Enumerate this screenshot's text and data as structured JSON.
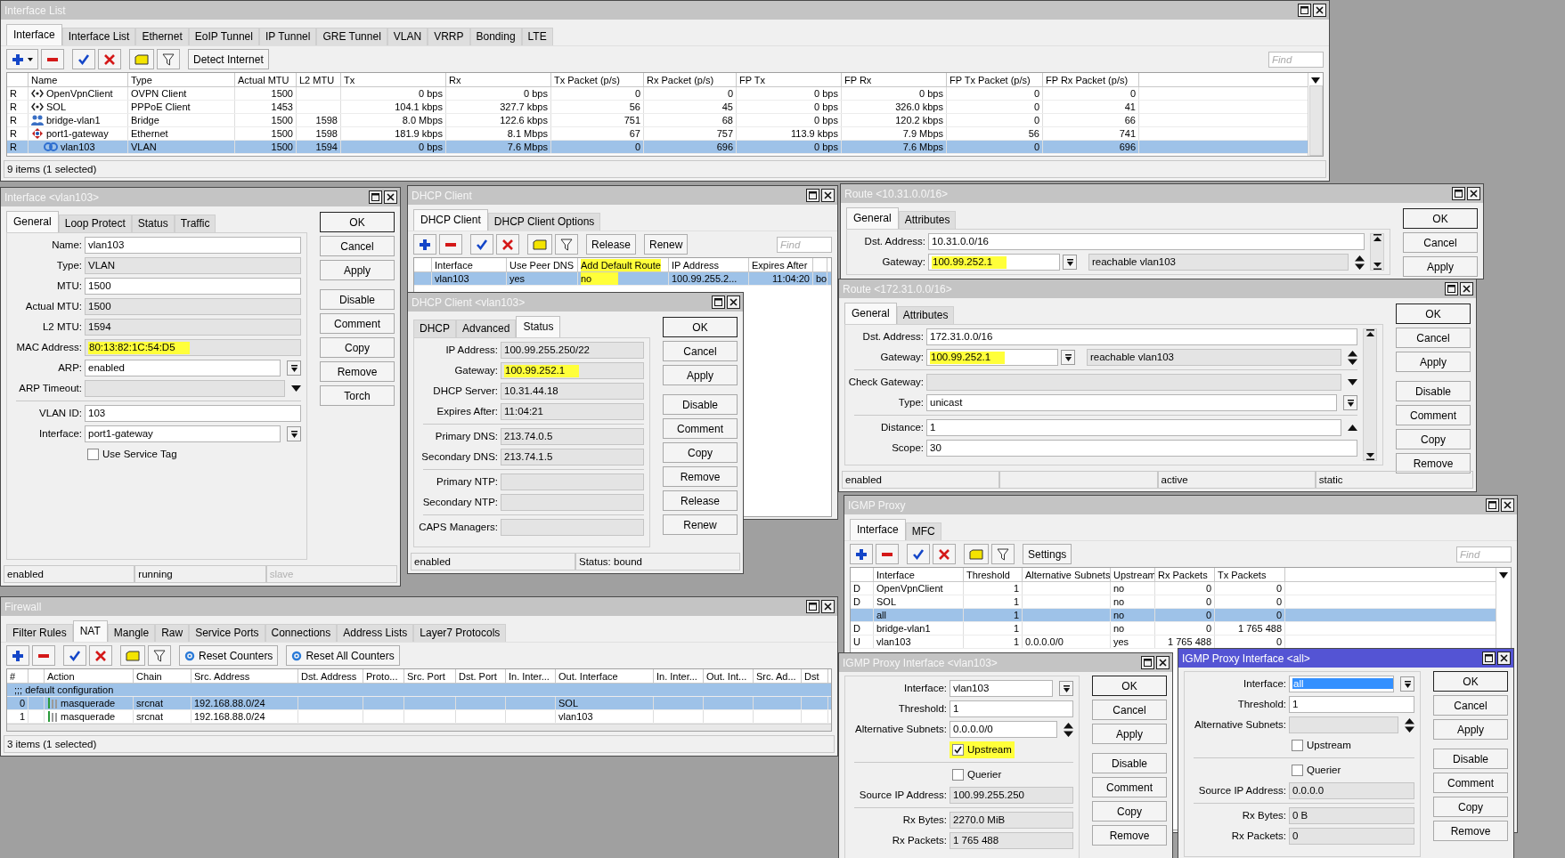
{
  "windows": [
    {
      "title": "Interface List",
      "active": false,
      "tabs": [
        {
          "label": "Interface",
          "selected": true
        },
        {
          "label": "Interface List",
          "selected": false
        },
        {
          "label": "Ethernet",
          "selected": false
        },
        {
          "label": "EoIP Tunnel",
          "selected": false
        },
        {
          "label": "IP Tunnel",
          "selected": false
        },
        {
          "label": "GRE Tunnel",
          "selected": false
        },
        {
          "label": "VLAN",
          "selected": false
        },
        {
          "label": "VRRP",
          "selected": false
        },
        {
          "label": "Bonding",
          "selected": false
        },
        {
          "label": "LTE",
          "selected": false
        }
      ],
      "toolbar": [
        {
          "kind": "add",
          "menu": true
        },
        {
          "kind": "remove"
        },
        {
          "kind": "enable"
        },
        {
          "kind": "disable"
        },
        {
          "kind": "comment"
        },
        {
          "kind": "filter"
        },
        {
          "kind": "button",
          "label": "Detect Internet"
        }
      ],
      "find": {
        "placeholder": "Find"
      },
      "table": {
        "columns": [
          "Name",
          "Type",
          "Actual MTU",
          "L2 MTU",
          "Tx",
          "Rx",
          "Tx Packet (p/s)",
          "Rx Packet (p/s)",
          "FP Tx",
          "FP Rx",
          "FP Tx Packet (p/s)",
          "FP Rx Packet (p/s)"
        ],
        "rows": [
          {
            "flag": "R",
            "kind": "tunnel",
            "selected": false,
            "cells": [
              "OpenVpnClient",
              "OVPN Client",
              "1500",
              null,
              "0 bps",
              "0 bps",
              "0",
              "0",
              "0 bps",
              "0 bps",
              "0",
              "0"
            ]
          },
          {
            "flag": "R",
            "kind": "tunnel",
            "selected": false,
            "cells": [
              "SOL",
              "PPPoE Client",
              "1453",
              null,
              "104.1 kbps",
              "327.7 kbps",
              "56",
              "45",
              "0 bps",
              "326.0 kbps",
              "0",
              "41"
            ]
          },
          {
            "flag": "R",
            "kind": "bridge",
            "selected": false,
            "cells": [
              "bridge-vlan1",
              "Bridge",
              "1500",
              "1598",
              "8.0 Mbps",
              "122.6 kbps",
              "751",
              "68",
              "0 bps",
              "120.2 kbps",
              "0",
              "66"
            ]
          },
          {
            "flag": "R",
            "kind": "ethernet",
            "selected": false,
            "cells": [
              "port1-gateway",
              "Ethernet",
              "1500",
              "1598",
              "181.9 kbps",
              "8.1 Mbps",
              "67",
              "757",
              "113.9 kbps",
              "7.9 Mbps",
              "56",
              "741"
            ],
            "children": [
              {
                "flag": "R",
                "kind": "vlan",
                "selected": true,
                "cells": [
                  "vlan103",
                  "VLAN",
                  "1500",
                  "1594",
                  "0 bps",
                  "7.6 Mbps",
                  "0",
                  "696",
                  "0 bps",
                  "7.6 Mbps",
                  "0",
                  "696"
                ]
              }
            ]
          }
        ]
      },
      "status": [
        {
          "text": "9 items (1 selected)"
        }
      ]
    },
    {
      "title": "Interface <vlan103>",
      "active": false,
      "tabs": [
        {
          "label": "General",
          "selected": true
        },
        {
          "label": "Loop Protect",
          "selected": false
        },
        {
          "label": "Status",
          "selected": false
        },
        {
          "label": "Traffic",
          "selected": false
        }
      ],
      "fields": [
        {
          "kind": "text",
          "label": "Name:",
          "value": "vlan103",
          "readonly": false
        },
        {
          "kind": "text",
          "label": "Type:",
          "value": "VLAN",
          "readonly": true
        },
        {
          "kind": "text",
          "label": "MTU:",
          "value": "1500",
          "readonly": false
        },
        {
          "kind": "text",
          "label": "Actual MTU:",
          "value": "1500",
          "readonly": true
        },
        {
          "kind": "text",
          "label": "L2 MTU:",
          "value": "1594",
          "readonly": true
        },
        {
          "kind": "text",
          "label": "MAC Address:",
          "value": "80:13:82:1C:54:D5",
          "readonly": true,
          "highlighted": true
        },
        {
          "kind": "select",
          "label": "ARP:",
          "value": "enabled",
          "readonly": false
        },
        {
          "kind": "dropdown",
          "label": "ARP Timeout:",
          "readonly": true
        },
        {
          "kind": "separator"
        },
        {
          "kind": "text",
          "label": "VLAN ID:",
          "value": "103",
          "readonly": false
        },
        {
          "kind": "select",
          "label": "Interface:",
          "value": "port1-gateway",
          "readonly": false
        },
        {
          "kind": "checkbox",
          "label": "Use Service Tag",
          "checked": false
        }
      ],
      "buttons": [
        "OK",
        "Cancel",
        "Apply",
        "Disable",
        "Comment",
        "Copy",
        "Remove",
        "Torch"
      ],
      "status": [
        {
          "text": "enabled",
          "disabled": false
        },
        {
          "text": "running",
          "disabled": false
        },
        {
          "text": "slave",
          "disabled": true
        }
      ]
    },
    {
      "title": "DHCP Client",
      "active": false,
      "tabs": [
        {
          "label": "DHCP Client",
          "selected": true
        },
        {
          "label": "DHCP Client Options",
          "selected": false
        }
      ],
      "toolbar": [
        {
          "kind": "add",
          "menu": false
        },
        {
          "kind": "remove"
        },
        {
          "kind": "enable"
        },
        {
          "kind": "disable"
        },
        {
          "kind": "comment"
        },
        {
          "kind": "filter"
        },
        {
          "kind": "button",
          "label": "Release"
        },
        {
          "kind": "button",
          "label": "Renew"
        }
      ],
      "find": {
        "placeholder": "Find"
      },
      "table": {
        "columns": [
          "Interface",
          "Use Peer DNS",
          {
            "label": "Add Default Route",
            "highlighted": true
          },
          "IP Address",
          "Expires After",
          null
        ],
        "rows": [
          {
            "flag": null,
            "kind": "none",
            "selected": true,
            "cells": [
              "vlan103",
              "yes",
              {
                "text": "no",
                "highlighted": true
              },
              "100.99.255.2...",
              "11:04:20",
              "bo"
            ]
          }
        ]
      }
    },
    {
      "title": "DHCP Client <vlan103>",
      "active": false,
      "tabs": [
        {
          "label": "DHCP",
          "selected": false
        },
        {
          "label": "Advanced",
          "selected": false
        },
        {
          "label": "Status",
          "selected": true
        }
      ],
      "fields": [
        {
          "kind": "text",
          "label": "IP Address:",
          "value": "100.99.255.250/22",
          "readonly": true
        },
        {
          "kind": "text",
          "label": "Gateway:",
          "value": "100.99.252.1",
          "readonly": true,
          "highlighted": true
        },
        {
          "kind": "text",
          "label": "DHCP Server:",
          "value": "10.31.44.18",
          "readonly": true
        },
        {
          "kind": "text",
          "label": "Expires After:",
          "value": "11:04:21",
          "readonly": true
        },
        {
          "kind": "separator"
        },
        {
          "kind": "text",
          "label": "Primary DNS:",
          "value": "213.74.0.5",
          "readonly": true
        },
        {
          "kind": "text",
          "label": "Secondary DNS:",
          "value": "213.74.1.5",
          "readonly": true
        },
        {
          "kind": "separator"
        },
        {
          "kind": "text",
          "label": "Primary NTP:",
          "readonly": true
        },
        {
          "kind": "text",
          "label": "Secondary NTP:",
          "readonly": true
        },
        {
          "kind": "separator"
        },
        {
          "kind": "text",
          "label": "CAPS Managers:",
          "readonly": true
        }
      ],
      "buttons": [
        "OK",
        "Cancel",
        "Apply",
        "Disable",
        "Comment",
        "Copy",
        "Remove",
        "Release",
        "Renew"
      ],
      "status": [
        {
          "text": "enabled"
        },
        {
          "text": "Status: bound"
        }
      ]
    },
    {
      "title": "Route <10.31.0.0/16>",
      "active": false,
      "tabs": [
        {
          "label": "General",
          "selected": true
        },
        {
          "label": "Attributes",
          "selected": false
        }
      ],
      "fields": [
        {
          "kind": "text",
          "label": "Dst. Address:",
          "value": "10.31.0.0/16",
          "readonly": false
        },
        {
          "kind": "gateway",
          "label": "Gateway:",
          "value": "100.99.252.1",
          "state": "reachable vlan103",
          "readonly": false,
          "highlighted": true
        }
      ],
      "buttons": [
        "OK",
        "Cancel",
        "Apply"
      ]
    },
    {
      "title": "Route <172.31.0.0/16>",
      "active": false,
      "tabs": [
        {
          "label": "General",
          "selected": true
        },
        {
          "label": "Attributes",
          "selected": false
        }
      ],
      "fields": [
        {
          "kind": "text",
          "label": "Dst. Address:",
          "value": "172.31.0.0/16",
          "readonly": false
        },
        {
          "kind": "gateway",
          "label": "Gateway:",
          "value": "100.99.252.1",
          "state": "reachable vlan103",
          "readonly": false,
          "highlighted": true
        },
        {
          "kind": "separator"
        },
        {
          "kind": "dropdown",
          "label": "Check Gateway:",
          "readonly": true
        },
        {
          "kind": "select",
          "label": "Type:",
          "value": "unicast",
          "readonly": false
        },
        {
          "kind": "separator"
        },
        {
          "kind": "up",
          "label": "Distance:",
          "value": "1",
          "readonly": false
        },
        {
          "kind": "text",
          "label": "Scope:",
          "value": "30",
          "readonly": false
        }
      ],
      "buttons": [
        "OK",
        "Cancel",
        "Apply",
        "Disable",
        "Comment",
        "Copy",
        "Remove"
      ],
      "status": [
        {
          "text": "enabled"
        },
        {
          "text": "active"
        },
        {
          "text": "static"
        }
      ]
    },
    {
      "title": "Firewall",
      "active": false,
      "tabs": [
        {
          "label": "Filter Rules",
          "selected": false
        },
        {
          "label": "NAT",
          "selected": true
        },
        {
          "label": "Mangle",
          "selected": false
        },
        {
          "label": "Raw",
          "selected": false
        },
        {
          "label": "Service Ports",
          "selected": false
        },
        {
          "label": "Connections",
          "selected": false
        },
        {
          "label": "Address Lists",
          "selected": false
        },
        {
          "label": "Layer7 Protocols",
          "selected": false
        }
      ],
      "toolbar": [
        {
          "kind": "add",
          "menu": false
        },
        {
          "kind": "remove"
        },
        {
          "kind": "enable"
        },
        {
          "kind": "disable"
        },
        {
          "kind": "comment"
        },
        {
          "kind": "filter"
        },
        {
          "kind": "reset",
          "label": "Reset Counters"
        },
        {
          "kind": "reset",
          "label": "Reset All Counters"
        }
      ],
      "table": {
        "columns": [
          "#",
          null,
          "Action",
          "Chain",
          "Src. Address",
          "Dst. Address",
          "Proto...",
          "Src. Port",
          "Dst. Port",
          "In. Inter...",
          "Out. Interface",
          "In. Inter...",
          "Out. Int...",
          "Src. Ad...",
          "Dst"
        ],
        "rows": [
          {
            "kind": "comment",
            "text": ";;; default configuration",
            "selected": true
          },
          {
            "kind": "masquerade",
            "selected": true,
            "cells": [
              "0",
              null,
              "masquerade",
              "srcnat",
              "192.168.88.0/24",
              null,
              null,
              null,
              null,
              null,
              "SOL",
              null,
              null,
              null,
              null
            ]
          },
          {
            "kind": "masquerade",
            "selected": false,
            "cells": [
              "1",
              null,
              "masquerade",
              "srcnat",
              "192.168.88.0/24",
              null,
              null,
              null,
              null,
              null,
              "vlan103",
              null,
              null,
              null,
              null
            ]
          }
        ]
      },
      "status": [
        {
          "text": "3 items (1 selected)"
        }
      ]
    },
    {
      "title": "IGMP Proxy",
      "active": false,
      "tabs": [
        {
          "label": "Interface",
          "selected": true
        },
        {
          "label": "MFC",
          "selected": false
        }
      ],
      "toolbar": [
        {
          "kind": "add",
          "menu": false
        },
        {
          "kind": "remove"
        },
        {
          "kind": "enable"
        },
        {
          "kind": "disable"
        },
        {
          "kind": "comment"
        },
        {
          "kind": "filter"
        },
        {
          "kind": "button",
          "label": "Settings"
        }
      ],
      "find": {
        "placeholder": "Find"
      },
      "table": {
        "columns": [
          "Interface",
          "Threshold",
          "Alternative Subnets",
          "Upstream",
          "Rx Packets",
          "Tx Packets"
        ],
        "rows": [
          {
            "flag": "D",
            "kind": "none",
            "selected": false,
            "cells": [
              "OpenVpnClient",
              "1",
              null,
              "no",
              "0",
              "0"
            ]
          },
          {
            "flag": "D",
            "kind": "none",
            "selected": false,
            "cells": [
              "SOL",
              "1",
              null,
              "no",
              "0",
              "0"
            ]
          },
          {
            "flag": null,
            "kind": "none",
            "selected": true,
            "cells": [
              "all",
              "1",
              null,
              "no",
              "0",
              "0"
            ]
          },
          {
            "flag": "D",
            "kind": "none",
            "selected": false,
            "cells": [
              "bridge-vlan1",
              "1",
              null,
              "no",
              "0",
              "1 765 488"
            ]
          },
          {
            "flag": "U",
            "kind": "none",
            "selected": false,
            "cells": [
              "vlan103",
              "1",
              "0.0.0.0/0",
              "yes",
              "1 765 488",
              "0"
            ]
          }
        ]
      }
    },
    {
      "title": "IGMP Proxy Interface <vlan103>",
      "active": false,
      "fields": [
        {
          "kind": "select",
          "label": "Interface:",
          "value": "vlan103",
          "readonly": false
        },
        {
          "kind": "text",
          "label": "Threshold:",
          "value": "1",
          "readonly": false
        },
        {
          "kind": "spin",
          "label": "Alternative Subnets:",
          "value": "0.0.0.0/0",
          "readonly": false
        },
        {
          "kind": "checkbox",
          "label": "Upstream",
          "checked": true,
          "highlighted": true
        },
        {
          "kind": "separator"
        },
        {
          "kind": "checkbox",
          "label": "Querier",
          "checked": false
        },
        {
          "kind": "text",
          "label": "Source IP Address:",
          "value": "100.99.255.250",
          "readonly": true
        },
        {
          "kind": "separator"
        },
        {
          "kind": "text",
          "label": "Rx Bytes:",
          "value": "2270.0 MiB",
          "readonly": true
        },
        {
          "kind": "text",
          "label": "Rx Packets:",
          "value": "1 765 488",
          "readonly": true
        }
      ],
      "buttons": [
        "OK",
        "Cancel",
        "Apply",
        "Disable",
        "Comment",
        "Copy",
        "Remove"
      ]
    },
    {
      "title": "IGMP Proxy Interface <all>",
      "active": true,
      "fields": [
        {
          "kind": "select",
          "label": "Interface:",
          "value": "all",
          "readonly": false,
          "text_selected": true
        },
        {
          "kind": "text",
          "label": "Threshold:",
          "value": "1",
          "readonly": false
        },
        {
          "kind": "spin",
          "label": "Alternative Subnets:",
          "readonly": true
        },
        {
          "kind": "checkbox",
          "label": "Upstream",
          "checked": false
        },
        {
          "kind": "separator"
        },
        {
          "kind": "checkbox",
          "label": "Querier",
          "checked": false
        },
        {
          "kind": "text",
          "label": "Source IP Address:",
          "value": "0.0.0.0",
          "readonly": true
        },
        {
          "kind": "separator"
        },
        {
          "kind": "text",
          "label": "Rx Bytes:",
          "value": "0 B",
          "readonly": true
        },
        {
          "kind": "text",
          "label": "Rx Packets:",
          "value": "0",
          "readonly": true
        }
      ],
      "buttons": [
        "OK",
        "Cancel",
        "Apply",
        "Disable",
        "Comment",
        "Copy",
        "Remove"
      ]
    }
  ]
}
